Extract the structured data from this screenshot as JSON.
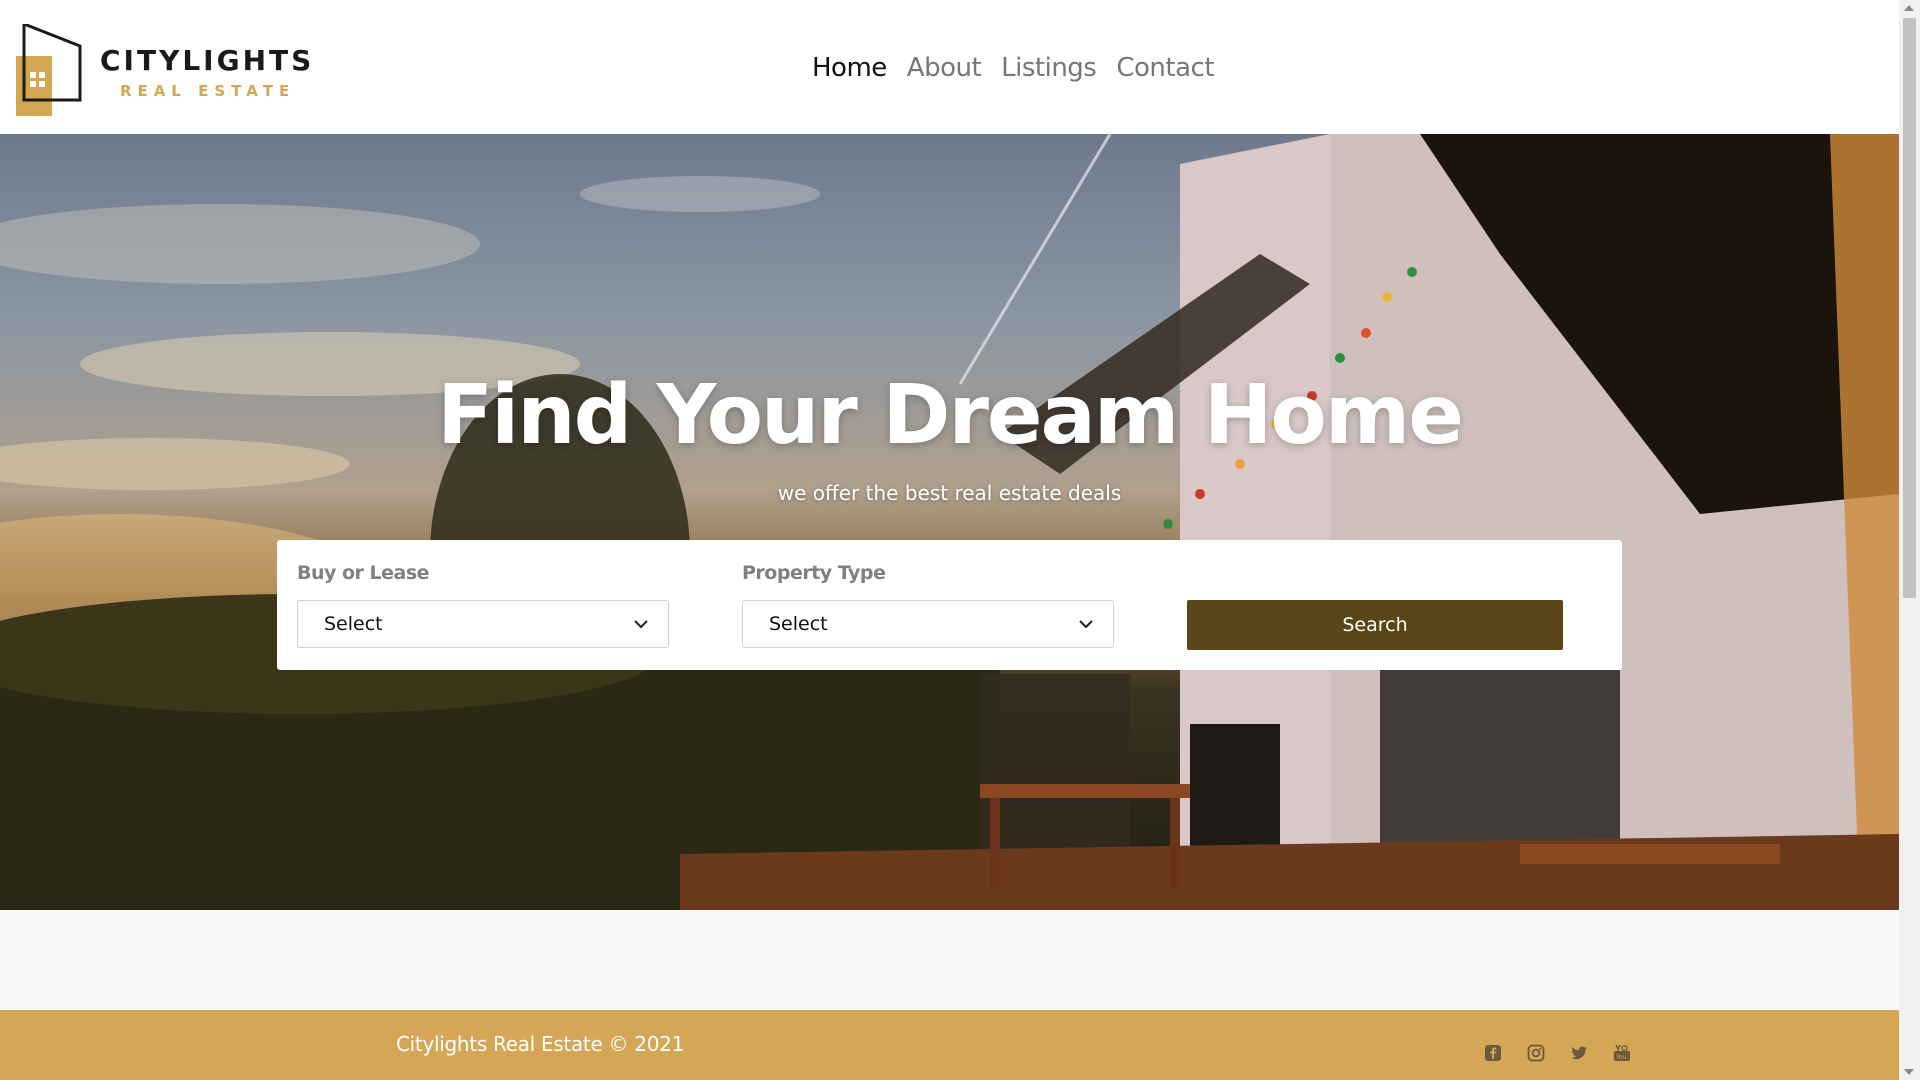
{
  "brand": {
    "name": "CITYLIGHTS",
    "tagline": "REAL ESTATE",
    "colors": {
      "gold": "#d4a655",
      "dark_gold": "#5a4616",
      "text_dark": "#111111"
    }
  },
  "nav": {
    "items": [
      {
        "label": "Home",
        "active": true
      },
      {
        "label": "About",
        "active": false
      },
      {
        "label": "Listings",
        "active": false
      },
      {
        "label": "Contact",
        "active": false
      }
    ]
  },
  "hero": {
    "title": "Find Your Dream Home",
    "subtitle": "we offer the best real estate deals"
  },
  "search": {
    "buy_lease": {
      "label": "Buy or Lease",
      "value": "Select"
    },
    "property_type": {
      "label": "Property Type",
      "value": "Select"
    },
    "button_label": "Search"
  },
  "footer": {
    "copyright": "Citylights Real Estate © 2021",
    "social_icons": [
      "facebook-icon",
      "instagram-icon",
      "twitter-icon",
      "youtube-icon"
    ]
  }
}
